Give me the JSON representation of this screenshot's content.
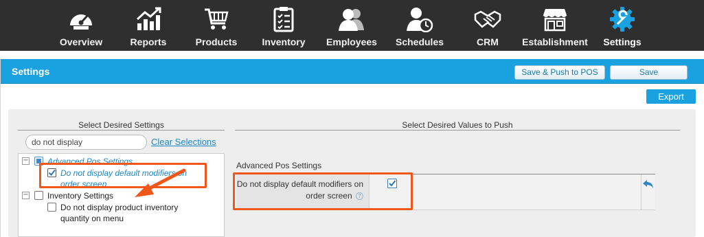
{
  "nav": {
    "items": [
      {
        "label": "Overview",
        "icon": "gauge-icon"
      },
      {
        "label": "Reports",
        "icon": "chart-icon"
      },
      {
        "label": "Products",
        "icon": "cart-icon"
      },
      {
        "label": "Inventory",
        "icon": "clipboard-icon"
      },
      {
        "label": "Employees",
        "icon": "people-icon"
      },
      {
        "label": "Schedules",
        "icon": "person-clock-icon"
      },
      {
        "label": "CRM",
        "icon": "handshake-icon"
      },
      {
        "label": "Establishment",
        "icon": "storefront-icon"
      },
      {
        "label": "Settings",
        "icon": "gear-icon",
        "active": true
      }
    ]
  },
  "header": {
    "title": "Settings",
    "save_push_label": "Save & Push to POS",
    "save_label": "Save",
    "export_label": "Export"
  },
  "left": {
    "heading": "Select Desired Settings",
    "search_value": "do not display",
    "clear_label": "Clear Selections",
    "tree": [
      {
        "label": "Advanced Pos Settings",
        "state": "partial",
        "children": [
          {
            "label": "Do not display default modifiers on order screen",
            "checked": true
          }
        ]
      },
      {
        "label": "Inventory Settings",
        "state": "unchecked",
        "children": [
          {
            "label": "Do not display product inventory quantity on menu",
            "checked": false
          }
        ]
      }
    ]
  },
  "right": {
    "heading": "Select Desired Values to Push",
    "group_title": "Advanced Pos Settings",
    "row_label": "Do not display default modifiers on order screen",
    "row_checked": true
  },
  "colors": {
    "accent": "#1aa1df",
    "highlight": "#f0571a",
    "nav_bg": "#2f2f2f"
  }
}
